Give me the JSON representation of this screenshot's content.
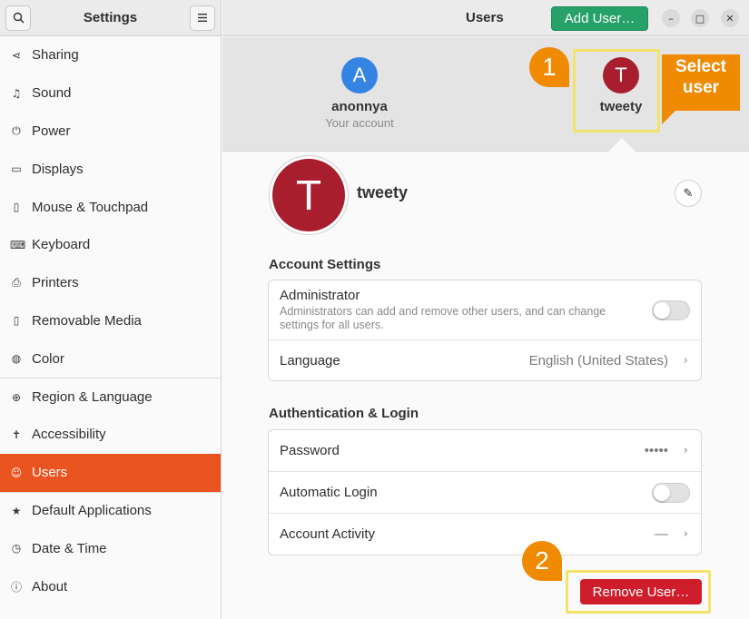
{
  "sidebar": {
    "title": "Settings",
    "search_icon": "search-icon",
    "menu_icon": "hamburger-icon",
    "items": [
      {
        "label": "Sharing",
        "icon": "share-icon",
        "glyph": "⋖"
      },
      {
        "label": "Sound",
        "icon": "music-note-icon",
        "glyph": "♫"
      },
      {
        "label": "Power",
        "icon": "power-icon",
        "glyph": "⏻"
      },
      {
        "label": "Displays",
        "icon": "monitor-icon",
        "glyph": "▭"
      },
      {
        "label": "Mouse & Touchpad",
        "icon": "mouse-icon",
        "glyph": "▯"
      },
      {
        "label": "Keyboard",
        "icon": "keyboard-icon",
        "glyph": "⌨"
      },
      {
        "label": "Printers",
        "icon": "printer-icon",
        "glyph": "⎙"
      },
      {
        "label": "Removable Media",
        "icon": "usb-drive-icon",
        "glyph": "▯"
      },
      {
        "label": "Color",
        "icon": "color-icon",
        "glyph": "◍"
      },
      {
        "label": "Region & Language",
        "icon": "globe-icon",
        "glyph": "⊕"
      },
      {
        "label": "Accessibility",
        "icon": "accessibility-icon",
        "glyph": "✝"
      },
      {
        "label": "Users",
        "icon": "users-icon",
        "glyph": "☺"
      },
      {
        "label": "Default Applications",
        "icon": "star-icon",
        "glyph": "★"
      },
      {
        "label": "Date & Time",
        "icon": "clock-icon",
        "glyph": "◷"
      },
      {
        "label": "About",
        "icon": "info-icon",
        "glyph": "ⓘ"
      }
    ],
    "active_index": 11
  },
  "header": {
    "title": "Users",
    "add_user_label": "Add User…",
    "minimize_glyph": "–",
    "maximize_glyph": "□",
    "close_glyph": "✕"
  },
  "users": [
    {
      "initial": "A",
      "name": "anonnya",
      "sub": "Your account",
      "color": "#3584e4"
    },
    {
      "initial": "T",
      "name": "tweety",
      "sub": "",
      "color": "#a91e2e"
    }
  ],
  "annotations": {
    "step1": "1",
    "step2": "2",
    "callout_line1": "Select",
    "callout_line2": "user",
    "accent": "#f08a00",
    "highlight": "#f3e36b"
  },
  "selected_user": {
    "initial": "T",
    "name": "tweety",
    "edit_icon": "pencil-icon",
    "edit_glyph": "✎"
  },
  "account_settings": {
    "title": "Account Settings",
    "administrator_label": "Administrator",
    "administrator_desc": "Administrators can add and remove other users, and can change settings for all users.",
    "administrator_on": false,
    "language_label": "Language",
    "language_value": "English (United States)"
  },
  "auth": {
    "title": "Authentication & Login",
    "password_label": "Password",
    "password_value": "•••••",
    "autologin_label": "Automatic Login",
    "autologin_on": false,
    "activity_label": "Account Activity",
    "activity_value": "—"
  },
  "remove_label": "Remove User…",
  "chevron": "›"
}
